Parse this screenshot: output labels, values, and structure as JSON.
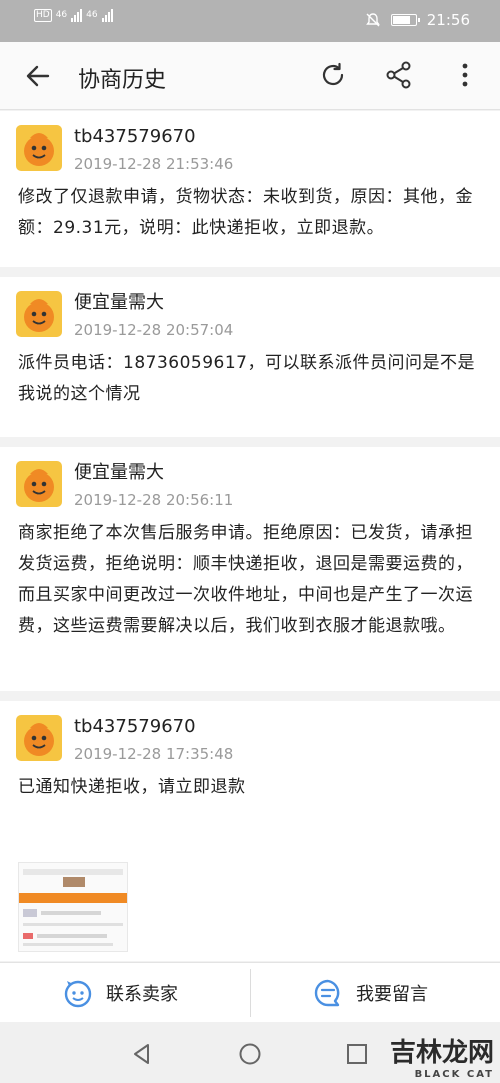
{
  "status_bar": {
    "left_labels": [
      "HD",
      "46",
      "46"
    ],
    "time": "21:56"
  },
  "app_bar": {
    "title": "协商历史"
  },
  "messages": [
    {
      "sender": "tb437579670",
      "time": "2019-12-28 21:53:46",
      "text": "修改了仅退款申请，货物状态：未收到货，原因：其他，金额：29.31元，说明：此快递拒收，立即退款。"
    },
    {
      "sender": "便宜量需大",
      "time": "2019-12-28 20:57:04",
      "text": "派件员电话：18736059617，可以联系派件员问问是不是我说的这个情况"
    },
    {
      "sender": "便宜量需大",
      "time": "2019-12-28 20:56:11",
      "text": "商家拒绝了本次售后服务申请。拒绝原因：已发货，请承担发货运费，拒绝说明：顺丰快递拒收，退回是需要运费的，而且买家中间更改过一次收件地址，中间也是产生了一次运费，这些运费需要解决以后，我们收到衣服才能退款哦。"
    },
    {
      "sender": "tb437579670",
      "time": "2019-12-28 17:35:48",
      "text": "已通知快递拒收，请立即退款"
    }
  ],
  "bottom_bar": {
    "contact_seller": "联系卖家",
    "leave_message": "我要留言"
  },
  "watermark": {
    "text": "吉林龙网",
    "sub": "BLACK CAT"
  }
}
